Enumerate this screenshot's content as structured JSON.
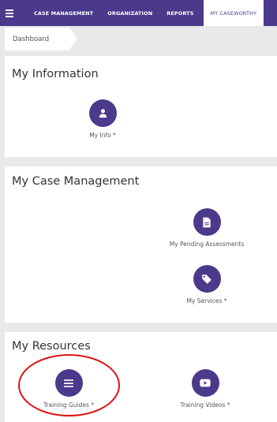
{
  "nav": {
    "items": [
      {
        "label": "CASE MANAGEMENT"
      },
      {
        "label": "ORGANIZATION"
      },
      {
        "label": "REPORTS"
      },
      {
        "label": "MY CASEWORTHY"
      }
    ]
  },
  "breadcrumb": {
    "label": "Dashboard"
  },
  "panels": {
    "info": {
      "title": "My Information",
      "tiles": [
        {
          "label": "My Info *",
          "icon": "person-icon"
        }
      ]
    },
    "case": {
      "title": "My Case Management",
      "tiles": [
        {
          "label": "My Pending Assessments",
          "icon": "document-icon"
        },
        {
          "label": "My Services *",
          "icon": "tag-icon"
        }
      ]
    },
    "resources": {
      "title": "My Resources",
      "tiles": [
        {
          "label": "Training Guides *",
          "icon": "list-icon"
        },
        {
          "label": "Training Videos *",
          "icon": "video-icon"
        }
      ]
    }
  },
  "colors": {
    "brand": "#4b3a8c",
    "highlight": "#e01010",
    "background": "#e9e9ec"
  }
}
